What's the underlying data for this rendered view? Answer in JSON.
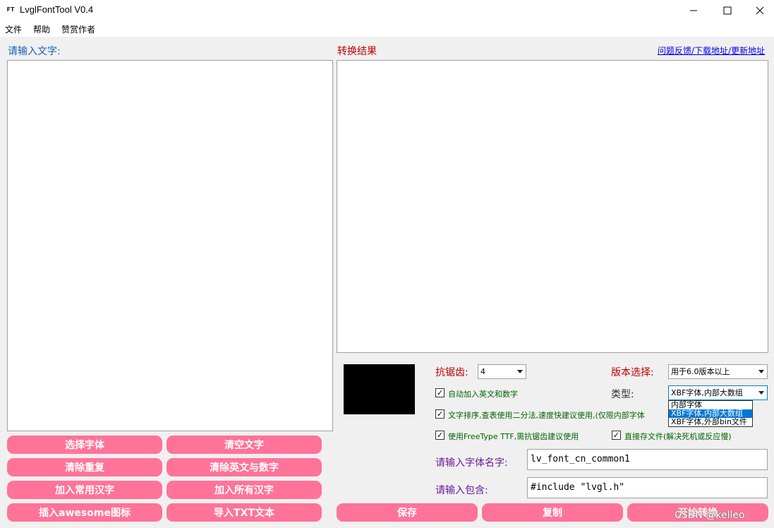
{
  "window": {
    "title": "LvglFontTool V0.4",
    "icon_text": "FT",
    "minimize": "—",
    "maximize": "☐",
    "close": "✕"
  },
  "menu": [
    "文件",
    "帮助",
    "赞赏作者"
  ],
  "left": {
    "input_label": "请输入文字:",
    "buttons": [
      "选择字体",
      "清空文字",
      "清除重复",
      "清除英文与数字",
      "加入常用汉字",
      "加入所有汉字",
      "插入awesome图标",
      "导入TXT文本"
    ]
  },
  "right": {
    "result_label": "转换结果",
    "link": "问题反馈/下载地址/更新地址",
    "preview_color": "#000000",
    "antialias_label": "抗锯齿:",
    "antialias_value": "4",
    "version_label": "版本选择:",
    "version_value": "用于6.0版本以上",
    "type_label": "类型:",
    "type_value": "XBF字体,内部大数组",
    "type_options": [
      "内部字体",
      "XBF字体,内部大数组",
      "XBF字体,外部bin文件"
    ],
    "checkboxes": {
      "auto_add": "自动加入英文和数字",
      "sort": "文字排序,查表使用二分法,速度快建议使用,(仅限内部字体",
      "freetype": "使用FreeType TTF,需抗锯齿建议使用",
      "direct_save": "直接存文件(解决死机或反应慢)"
    },
    "check_mark": "✓",
    "font_name_label": "请输入字体名字:",
    "font_name_value": "lv_font_cn_common1",
    "include_label": "请输入包含:",
    "include_value": "#include \"lvgl.h\"",
    "save_btn": "保存",
    "copy_btn": "复制",
    "convert_btn": "开始转换"
  },
  "watermark": "CSDN @kelleo",
  "colors": {
    "button_pink": "#ff7399",
    "label_blue": "#1560bd",
    "label_red": "#c00000",
    "selection_blue": "#0078d7"
  }
}
